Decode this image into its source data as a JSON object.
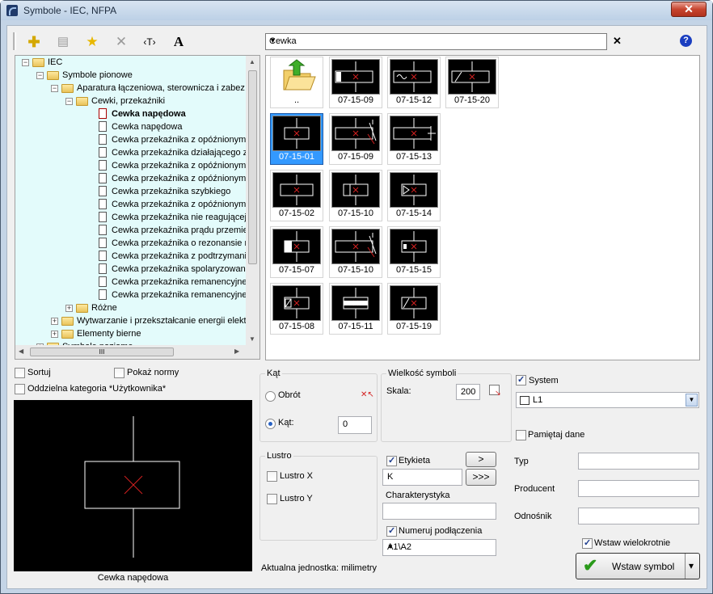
{
  "window": {
    "title": "Symbole - IEC, NFPA",
    "close_label": "✕"
  },
  "toolbar": {
    "icons": [
      "add-icon",
      "properties-icon",
      "favorite-star-icon",
      "delete-icon",
      "text-tag-icon",
      "font-style-icon"
    ],
    "text_tag_label": "‹T›",
    "font_style_label": "A"
  },
  "search": {
    "value": "Cewka",
    "clear_label": "✕",
    "help_label": "?"
  },
  "tree": {
    "items": [
      {
        "label": "IEC",
        "level": 0,
        "kind": "folder",
        "expander": "−"
      },
      {
        "label": "Symbole pionowe",
        "level": 1,
        "kind": "folder",
        "expander": "−"
      },
      {
        "label": "Aparatura łączeniowa, sterownicza i zabez",
        "level": 2,
        "kind": "folder",
        "expander": "−"
      },
      {
        "label": "Cewki, przekaźniki",
        "level": 3,
        "kind": "folder",
        "expander": "−"
      },
      {
        "label": "Cewka napędowa",
        "level": 4,
        "kind": "doc",
        "bold": true
      },
      {
        "label": "Cewka napędowa",
        "level": 4,
        "kind": "doc"
      },
      {
        "label": "Cewka przekaźnika z opóźnionym p",
        "level": 4,
        "kind": "doc"
      },
      {
        "label": "Cewka przekaźnika działającego z",
        "level": 4,
        "kind": "doc"
      },
      {
        "label": "Cewka przekaźnika z opóźnionym z",
        "level": 4,
        "kind": "doc"
      },
      {
        "label": "Cewka przekaźnika z opóźnionym z",
        "level": 4,
        "kind": "doc"
      },
      {
        "label": "Cewka przekaźnika szybkiego",
        "level": 4,
        "kind": "doc"
      },
      {
        "label": "Cewka przekaźnika z opóźnionym p",
        "level": 4,
        "kind": "doc"
      },
      {
        "label": "Cewka przekaźnika nie reagującej",
        "level": 4,
        "kind": "doc"
      },
      {
        "label": "Cewka przekaźnika prądu przemier",
        "level": 4,
        "kind": "doc"
      },
      {
        "label": "Cewka przekaźnika o rezonansie m",
        "level": 4,
        "kind": "doc"
      },
      {
        "label": "Cewka przekaźnika z podtrzymanie",
        "level": 4,
        "kind": "doc"
      },
      {
        "label": "Cewka przekaźnika spolaryzowana",
        "level": 4,
        "kind": "doc"
      },
      {
        "label": "Cewka przekaźnika remanencyjnej",
        "level": 4,
        "kind": "doc"
      },
      {
        "label": "Cewka przekaźnika remanencyjnej",
        "level": 4,
        "kind": "doc"
      },
      {
        "label": "Różne",
        "level": 3,
        "kind": "folder",
        "expander": "+"
      },
      {
        "label": "Wytwarzanie i przekształcanie energii elekt",
        "level": 2,
        "kind": "folder",
        "expander": "+"
      },
      {
        "label": "Elementy bierne",
        "level": 2,
        "kind": "folder",
        "expander": "+"
      },
      {
        "label": "Symbole poziome",
        "level": 1,
        "kind": "folder",
        "expander": "+"
      }
    ],
    "scroll_grip": "III"
  },
  "symbols": [
    {
      "code": "..",
      "variant": "up"
    },
    {
      "code": "07-15-09",
      "variant": "h-hatch"
    },
    {
      "code": "07-15-12",
      "variant": "h-wave"
    },
    {
      "code": "07-15-20",
      "variant": "h-diag"
    },
    {
      "code": "07-15-01",
      "variant": "v-plain",
      "selected": true
    },
    {
      "code": "07-15-09",
      "variant": "h-contact"
    },
    {
      "code": "07-15-13",
      "variant": "h-switch"
    },
    {
      "code": "07-15-02",
      "variant": "v-wide"
    },
    {
      "code": "07-15-10",
      "variant": "v-box"
    },
    {
      "code": "07-15-14",
      "variant": "v-tri"
    },
    {
      "code": "07-15-07",
      "variant": "v-fill"
    },
    {
      "code": "07-15-10",
      "variant": "h-contact2"
    },
    {
      "code": "07-15-15",
      "variant": "v-small"
    },
    {
      "code": "07-15-08",
      "variant": "v-hatch"
    },
    {
      "code": "07-15-11",
      "variant": "v-bar"
    },
    {
      "code": "07-15-19",
      "variant": "v-diag"
    }
  ],
  "options": {
    "sort_label": "Sortuj",
    "show_norms_label": "Pokaż normy",
    "separate_category_label": "Oddzielna kategoria *Użytkownika*"
  },
  "preview": {
    "caption": "Cewka napędowa"
  },
  "angle": {
    "group_title": "Kąt",
    "rotation_label": "Obrót",
    "angle_label": "Kąt:",
    "angle_value": "0"
  },
  "size": {
    "group_title": "Wielkość symboli",
    "scale_label": "Skala:",
    "scale_value": "200"
  },
  "mirror": {
    "group_title": "Lustro",
    "x_label": "Lustro X",
    "y_label": "Lustro Y"
  },
  "label": {
    "label_check": "Etykieta",
    "label_value": "K",
    "next_label": ">",
    "next_all_label": ">>>",
    "characteristic_label": "Charakterystyka",
    "characteristic_value": "",
    "number_label": "Numeruj podłączenia",
    "number_value": "A1\\A2"
  },
  "unit_text": "Aktualna jednostka: milimetry",
  "system": {
    "label": "System",
    "layer_value": "L1",
    "remember_label": "Pamiętaj dane"
  },
  "fields": {
    "type_label": "Typ",
    "producer_label": "Producent",
    "reference_label": "Odnośnik"
  },
  "insert": {
    "multi_label": "Wstaw wielokrotnie",
    "button_label": "Wstaw symbol",
    "dropdown_label": "▾"
  },
  "colors": {
    "tree_bg": "#e3fbfb",
    "selection": "#3399ff",
    "accent_red": "#d22020"
  }
}
